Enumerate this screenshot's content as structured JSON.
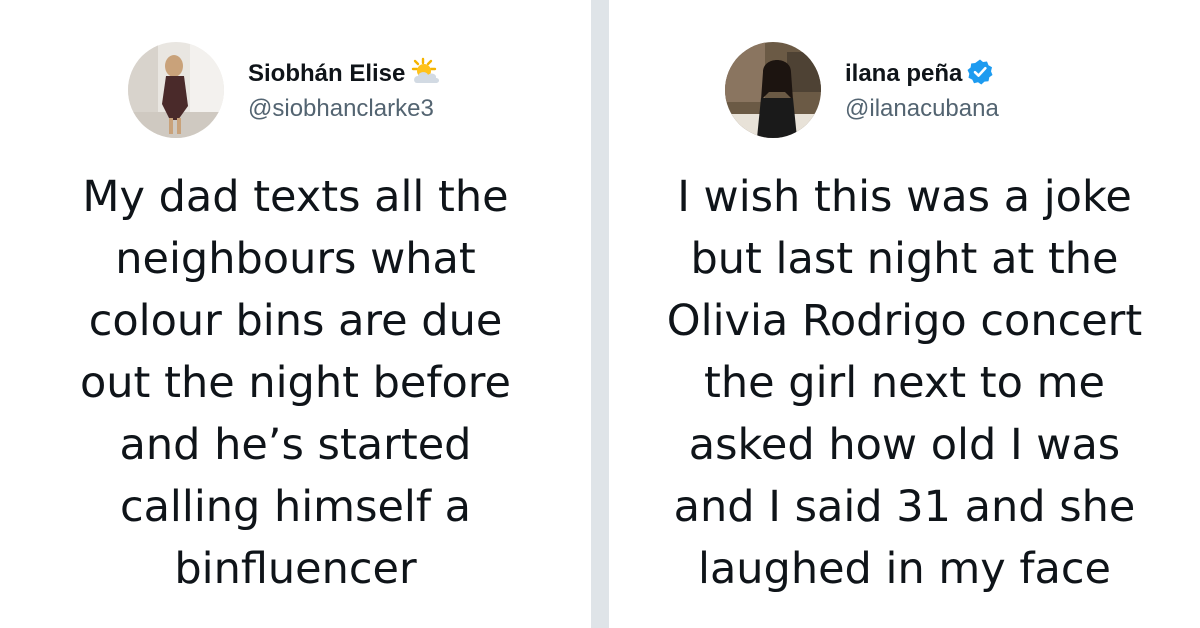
{
  "tweets": [
    {
      "display_name": "Siobhán Elise",
      "handle": "@siobhanclarke3",
      "name_icon": "sun-behind-cloud-emoji",
      "text_lines": [
        "My dad texts all the",
        "neighbours what",
        "colour bins are due",
        "out the night before",
        "and he’s started",
        "calling himself a",
        "binfluencer"
      ]
    },
    {
      "display_name": "ilana peña",
      "handle": "@ilanacubana",
      "name_icon": "verified-badge-icon",
      "text_lines": [
        "I wish this was a joke",
        "but last night at the",
        "Olivia Rodrigo concert",
        "the girl next to me",
        "asked how old I was",
        "and I said 31 and she",
        "laughed in my face"
      ]
    }
  ],
  "colors": {
    "text": "#0f1419",
    "handle": "#536471",
    "divider": "#dfe4e8",
    "verified": "#1d9bf0"
  }
}
